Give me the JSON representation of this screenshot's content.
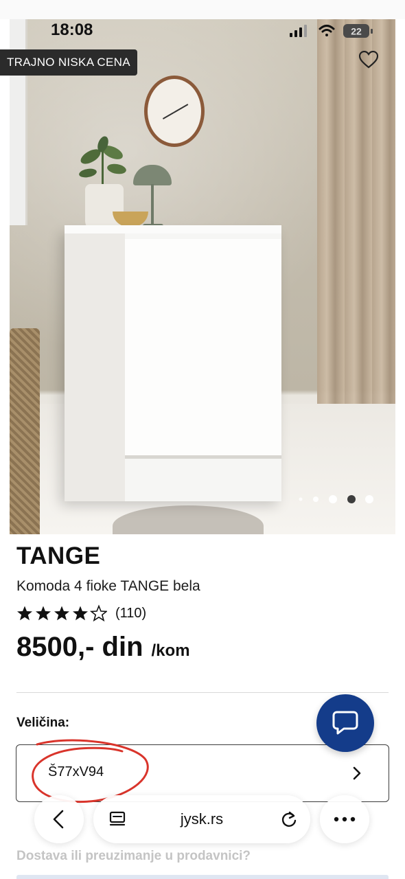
{
  "status_bar": {
    "time": "18:08",
    "battery": "22"
  },
  "hero": {
    "badge": "TRAJNO NISKA CENA",
    "slides": 5,
    "active_slide": 4
  },
  "product": {
    "brand": "TANGE",
    "name": "Komoda 4 fioke TANGE bela",
    "rating": 4,
    "rating_max": 5,
    "review_count": "(110)",
    "price": "8500,- din",
    "price_unit": "/kom"
  },
  "size": {
    "label": "Veličina:",
    "value": "Š77xV94"
  },
  "browser": {
    "domain": "jysk.rs"
  },
  "delivery": {
    "label": "Dostava ili preuzimanje u prodavnici?"
  },
  "colors": {
    "chat_button": "#143c8a",
    "highlight_circle": "#d9342b",
    "badge_bg": "#2b2b2b"
  },
  "icons": [
    "heart-icon",
    "chat-icon",
    "chevron-right-icon",
    "back-arrow-icon",
    "reader-icon",
    "reload-icon",
    "more-icon",
    "star-icon",
    "signal-icon",
    "wifi-icon",
    "battery-icon"
  ]
}
